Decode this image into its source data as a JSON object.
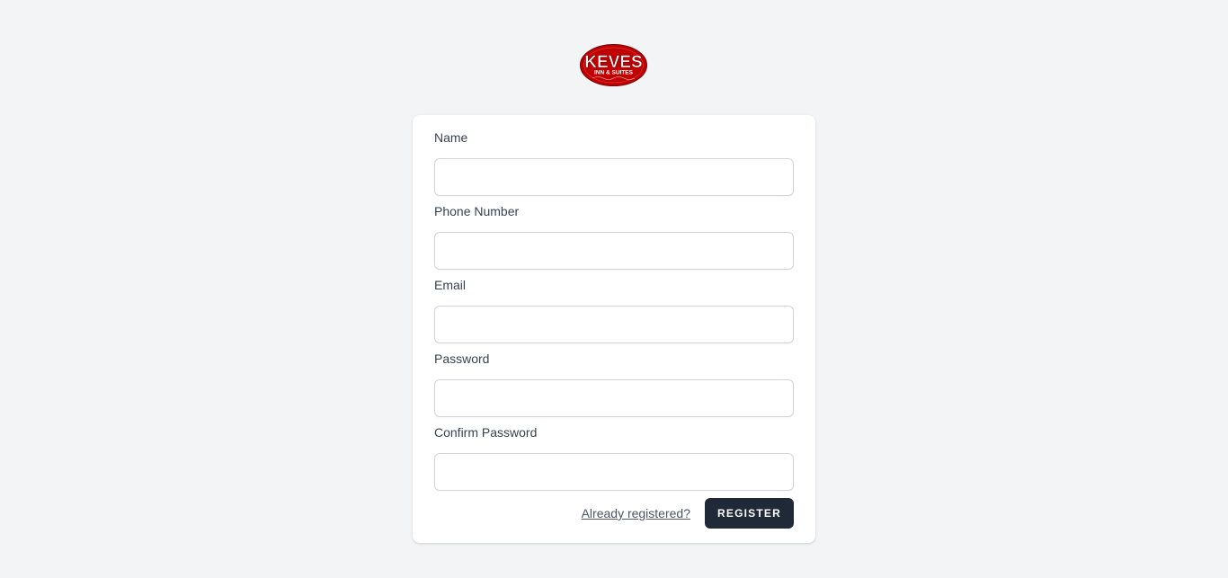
{
  "logo": {
    "name": "KEVES",
    "tagline": "INN & SUITES",
    "color": "#c00000"
  },
  "form": {
    "fields": [
      {
        "label": "Name",
        "value": "",
        "placeholder": ""
      },
      {
        "label": "Phone Number",
        "value": "",
        "placeholder": ""
      },
      {
        "label": "Email",
        "value": "",
        "placeholder": ""
      },
      {
        "label": "Password",
        "value": "",
        "placeholder": ""
      },
      {
        "label": "Confirm Password",
        "value": "",
        "placeholder": ""
      }
    ],
    "login_link": "Already registered?",
    "submit_label": "Register"
  },
  "colors": {
    "background": "#f3f4f6",
    "card": "#ffffff",
    "button": "#1f2937",
    "logo_red": "#c00000"
  }
}
